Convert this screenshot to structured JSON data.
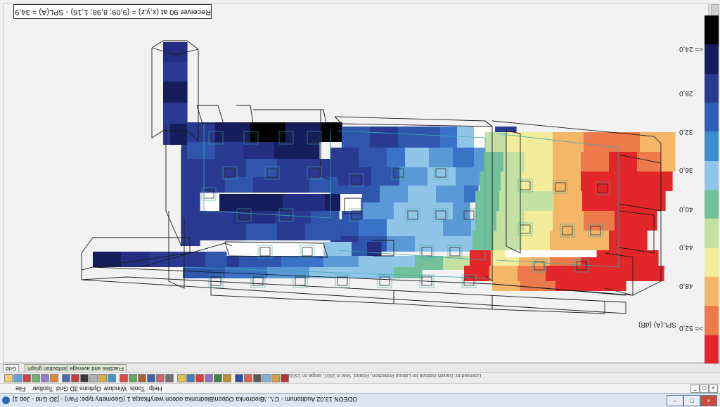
{
  "receiver_info": "Receiver 90 at (x,y,z) = (9,09; 8,98; 1,16)   -   SPL(A) = 34,9 dB",
  "legend": {
    "unit_label": "SPL(A) (dB)",
    "labels": [
      "<= 24,0",
      "28,0",
      "32,0",
      "36,0",
      "40,0",
      "44,0",
      "48,0",
      ">= 52,0"
    ],
    "colors": [
      "#000000",
      "#151d5c",
      "#2a3a92",
      "#2f5fb5",
      "#3c8ad0",
      "#8fc6e8",
      "#72c19a",
      "#c4e0a2",
      "#f3ec9a",
      "#f4b768",
      "#ec7a4a",
      "#e3262a"
    ]
  },
  "tabs": [
    "Grid",
    "Distribution graph",
    "Fractiles and average"
  ],
  "status_tip": "Licensed to: Danish Institute for Labour Protection, Poland. Year is 2007, single on 15/02/13",
  "menu": [
    "File",
    "Toolbar",
    "3D Grid",
    "Options",
    "Window",
    "Tools",
    "Help"
  ],
  "title": "ODEON 13.02 Auditorium - C:\\...\\Biedronka Odeon\\Biedronka odeon weryfikacja 1     (Geometry type: Pan) - [3D Grid - Job 1]",
  "window_buttons": [
    "minimize",
    "maximize",
    "close"
  ]
}
